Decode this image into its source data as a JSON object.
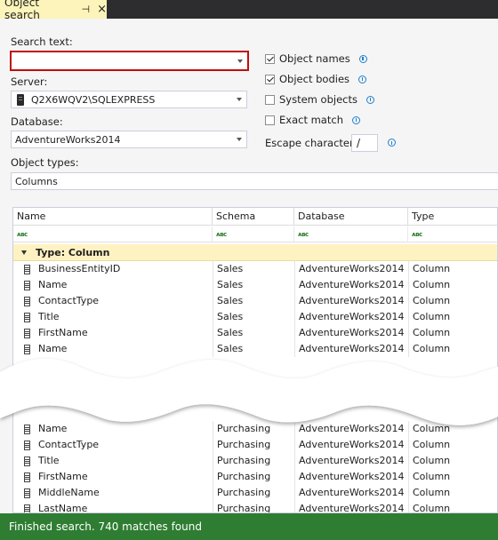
{
  "tab": {
    "title": "Object search",
    "pin_icon": "pin-icon",
    "close_icon": "close-icon"
  },
  "form": {
    "search_label": "Search text:",
    "search_value": "",
    "server_label": "Server:",
    "server_value": "Q2X6WQV2\\SQLEXPRESS",
    "database_label": "Database:",
    "database_value": "AdventureWorks2014",
    "object_types_label": "Object types:",
    "object_types_value": "Columns",
    "escape_label": "Escape character:",
    "escape_value": "/",
    "options": [
      {
        "label": "Object names",
        "checked": true
      },
      {
        "label": "Object bodies",
        "checked": true
      },
      {
        "label": "System objects",
        "checked": false
      },
      {
        "label": "Exact match",
        "checked": false
      }
    ]
  },
  "grid": {
    "columns": [
      "Name",
      "Schema",
      "Database",
      "Type"
    ],
    "filter_icon": "abc-filter-icon",
    "group_label": "Type: Column",
    "rows_top": [
      [
        "BusinessEntityID",
        "Sales",
        "AdventureWorks2014",
        "Column"
      ],
      [
        "Name",
        "Sales",
        "AdventureWorks2014",
        "Column"
      ],
      [
        "ContactType",
        "Sales",
        "AdventureWorks2014",
        "Column"
      ],
      [
        "Title",
        "Sales",
        "AdventureWorks2014",
        "Column"
      ],
      [
        "FirstName",
        "Sales",
        "AdventureWorks2014",
        "Column"
      ],
      [
        "Name",
        "Sales",
        "AdventureWorks2014",
        "Column"
      ]
    ],
    "rows_bottom": [
      [
        "Name",
        "Purchasing",
        "AdventureWorks2014",
        "Column"
      ],
      [
        "ContactType",
        "Purchasing",
        "AdventureWorks2014",
        "Column"
      ],
      [
        "Title",
        "Purchasing",
        "AdventureWorks2014",
        "Column"
      ],
      [
        "FirstName",
        "Purchasing",
        "AdventureWorks2014",
        "Column"
      ],
      [
        "MiddleName",
        "Purchasing",
        "AdventureWorks2014",
        "Column"
      ],
      [
        "LastName",
        "Purchasing",
        "AdventureWorks2014",
        "Column"
      ]
    ]
  },
  "status": {
    "text": "Finished search. 740 matches found",
    "color": "#2e7d32"
  }
}
